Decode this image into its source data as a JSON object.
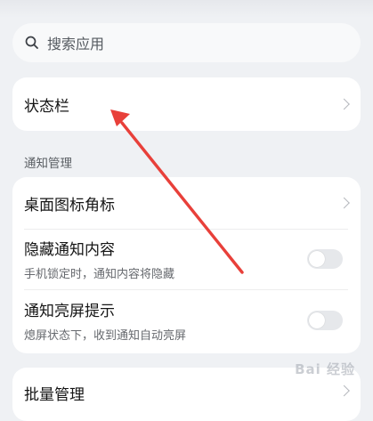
{
  "search": {
    "placeholder": "搜索应用",
    "icon": "search-icon"
  },
  "status_bar_item": {
    "label": "状态栏"
  },
  "notification_section": {
    "title": "通知管理",
    "items": [
      {
        "label": "桌面图标角标",
        "type": "link"
      },
      {
        "label": "隐藏通知内容",
        "subtitle": "手机锁定时，通知内容将隐藏",
        "type": "toggle",
        "on": false
      },
      {
        "label": "通知亮屏提示",
        "subtitle": "熄屏状态下，收到通知自动亮屏",
        "type": "toggle",
        "on": false
      }
    ]
  },
  "batch_item": {
    "label": "批量管理"
  },
  "annotation": {
    "color": "#e8403a"
  },
  "watermark": {
    "text": "Bai 经验"
  }
}
